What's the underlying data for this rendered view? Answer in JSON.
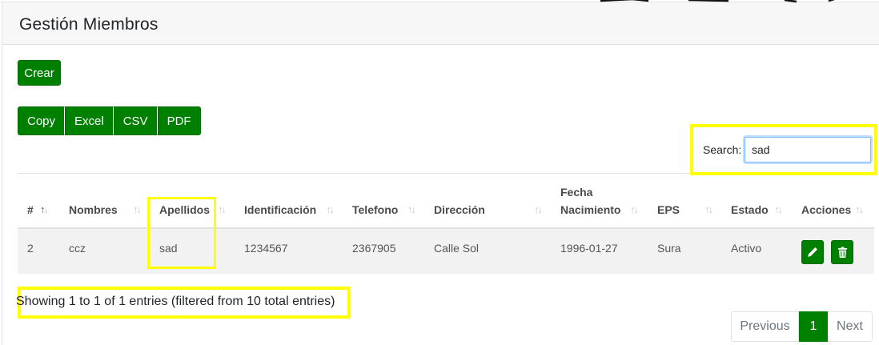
{
  "page": {
    "title": "Gestión Miembros"
  },
  "actions": {
    "create_label": "Crear"
  },
  "export_buttons": [
    "Copy",
    "Excel",
    "CSV",
    "PDF"
  ],
  "search": {
    "label": "Search:",
    "value": "sad"
  },
  "table": {
    "columns": [
      "#",
      "Nombres",
      "Apellidos",
      "Identificación",
      "Telefono",
      "Dirección",
      "Fecha",
      "Nacimiento",
      "EPS",
      "Estado",
      "Acciones"
    ],
    "rows": [
      {
        "num": "2",
        "nombres": "ccz",
        "apellidos": "sad",
        "identificacion": "1234567",
        "telefono": "2367905",
        "direccion": "Calle Sol",
        "fecha_nacimiento": "1996-01-27",
        "eps": "Sura",
        "estado": "Activo"
      }
    ],
    "row_actions": [
      {
        "icon": "pencil-icon"
      },
      {
        "icon": "trash-icon"
      }
    ]
  },
  "info": {
    "text": "Showing 1 to 1 of 1 entries (filtered from 10 total entries)"
  },
  "pagination": {
    "previous": "Previous",
    "current": "1",
    "next": "Next"
  },
  "colors": {
    "brand_green": "#008000",
    "highlight": "#ffff00",
    "header_bg": "#f7f7f7"
  }
}
